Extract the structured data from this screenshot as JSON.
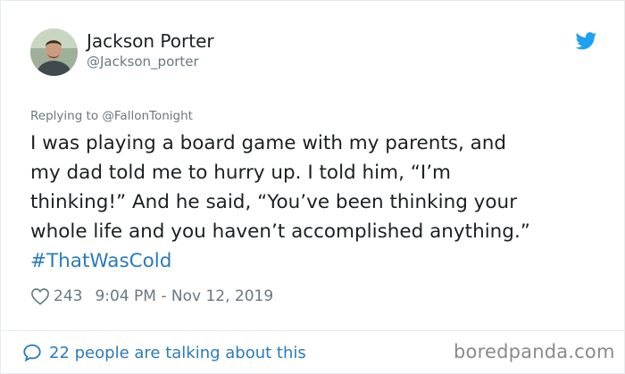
{
  "author": {
    "name": "Jackson Porter",
    "handle": "@Jackson_porter",
    "avatar": "profile-photo"
  },
  "icons": {
    "bird": "twitter-bird-icon",
    "heart": "heart-icon",
    "bubble": "speech-bubble-icon",
    "brand_color": "#1da1f2",
    "link_color": "#2b7bb9"
  },
  "reply": {
    "prefix": "Replying to",
    "target": "@FallonTonight"
  },
  "tweet": {
    "lines": [
      "I was playing a board game with my parents, and",
      "my dad told me to hurry up. I told him, “I’m",
      "thinking!” And he said, “You’ve been thinking your",
      "whole life and you haven’t accomplished anything.”"
    ],
    "hashtag": "#ThatWasCold"
  },
  "meta": {
    "likes": "243",
    "timestamp": "9:04 PM - Nov 12, 2019"
  },
  "footer": {
    "talking": "22 people are talking about this"
  },
  "watermark": "boredpanda.com"
}
